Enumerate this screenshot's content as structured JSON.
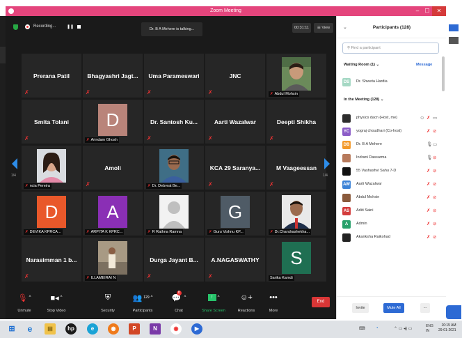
{
  "window": {
    "title": "Zoom Meeting",
    "minimize": "–",
    "maximize": "☐",
    "close": "✕"
  },
  "topbar": {
    "recording_label": "Recording...",
    "pause": "❚❚",
    "talking": "Dr. B A Mehere is talking...",
    "timer": "00:31:11",
    "view": "☰ View"
  },
  "tiles": [
    {
      "name": "Prerana Patil"
    },
    {
      "name": "Bhagyashri Jagt..."
    },
    {
      "name": "Uma Parameswari"
    },
    {
      "name": "JNC"
    },
    {
      "caption": "Abdul Mohsin"
    },
    {
      "name": "Smita Tolani"
    },
    {
      "initial": "D",
      "caption": "Arindam Ghosh"
    },
    {
      "name": "Dr. Santosh Ku..."
    },
    {
      "name": "Aarti Wazalwar"
    },
    {
      "name": "Deepti Shikha"
    },
    {
      "caption": "ncia Pereira"
    },
    {
      "name": "Amoli"
    },
    {
      "caption": "Dr. Debvrat Be..."
    },
    {
      "name": "KCA 29 Saranya..."
    },
    {
      "name": "M Vaageessan"
    },
    {
      "initial": "D",
      "caption": "DEVIKA KPRCA..."
    },
    {
      "initial": "A",
      "caption": "ARPITA K KPRC..."
    },
    {
      "caption": "R Rathna Ramna"
    },
    {
      "initial": "G",
      "caption": "Guru Vishnu KP..."
    },
    {
      "caption": "Dr.Chandrashekha..."
    },
    {
      "name": "Narasimman 1 b..."
    },
    {
      "caption": "ILLAMEIRAI N"
    },
    {
      "name": "Durga Jayant B..."
    },
    {
      "name": "A.NAGASWATHY"
    },
    {
      "initial": "S",
      "caption": "Sarika Kamdi"
    }
  ],
  "pager": {
    "left": "1/4",
    "right": "1/4"
  },
  "toolbar": {
    "unmute": "Unmute",
    "stop_video": "Stop Video",
    "security": "Security",
    "participants": "Participants",
    "participants_count": "129",
    "chat": "Chat",
    "chat_badge": "8",
    "share_screen": "Share Screen",
    "reactions": "Reactions",
    "more": "More",
    "end": "End"
  },
  "panel": {
    "title": "Participants (128)",
    "search_placeholder": "Find a participant",
    "waiting_room": "Waiting Room (1)",
    "message": "Message",
    "waiting": [
      {
        "name": "Dr. Shweta Hardia",
        "initials": "DS"
      }
    ],
    "in_meeting": "In the Meeting (128)",
    "participants": [
      {
        "name": "physics dacn (Host, me)",
        "initials": "",
        "color": "#2d2d2d"
      },
      {
        "name": "yograj choudhari (Co-host)",
        "initials": "YC",
        "color": "#8b5cc7"
      },
      {
        "name": "Dr. B A  Mehere",
        "initials": "DB",
        "color": "#f39a2b"
      },
      {
        "name": "Indrani Dassarma",
        "initials": "",
        "color": "#b77a5c"
      },
      {
        "name": "55 Vashashvi Sahu 7-D",
        "initials": "",
        "color": "#111111"
      },
      {
        "name": "Aarti Wazalwar",
        "initials": "AW",
        "color": "#3b82d6"
      },
      {
        "name": "Abdul Mohsin",
        "initials": "",
        "color": "#8a5a3c"
      },
      {
        "name": "Aditi Saini",
        "initials": "AS",
        "color": "#d33c3c"
      },
      {
        "name": "Admin",
        "initials": "A",
        "color": "#27a06a"
      },
      {
        "name": "Akanksha Raikohad",
        "initials": "",
        "color": "#222222"
      }
    ],
    "invite": "Invite",
    "mute_all": "Mute All",
    "more": "..."
  },
  "taskbar": {
    "lang1": "ENG",
    "lang2": "IN",
    "time": "10:15 AM",
    "date": "29-01-2021"
  },
  "colors": {
    "zoom_title": "#e4457c",
    "zoom_blue": "#2d6ad4",
    "end_red": "#d93636",
    "mute_red": "#e33333"
  }
}
